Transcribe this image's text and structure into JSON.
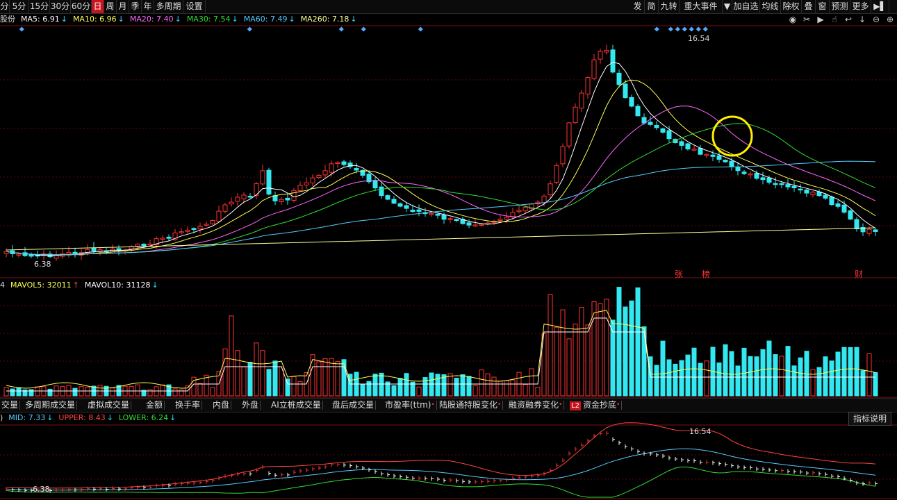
{
  "toolbar": {
    "left": [
      "分",
      "5分",
      "15分",
      "30分",
      "60分",
      "日",
      "周",
      "月",
      "季",
      "年",
      "多周期",
      "设置"
    ],
    "active_index": 5,
    "right": [
      "发",
      "简",
      "九转",
      "重大事件",
      "▼",
      "加自选",
      "均线",
      "除权",
      "叠",
      "窗",
      "预测",
      "更多",
      "▶▌"
    ]
  },
  "ma_row": {
    "prefix": "股份",
    "items": [
      {
        "text": "MA5: 6.91",
        "arrow": "↓",
        "color": "#ffffff"
      },
      {
        "text": "MA10: 6.96",
        "arrow": "↓",
        "color": "#ffff55"
      },
      {
        "text": "MA20: 7.40",
        "arrow": "↓",
        "color": "#ff66ff"
      },
      {
        "text": "MA30: 7.54",
        "arrow": "↓",
        "color": "#33dd33"
      },
      {
        "text": "MA60: 7.49",
        "arrow": "↓",
        "color": "#55ccff"
      },
      {
        "text": "MA260: 7.18",
        "arrow": "↓",
        "color": "#ffff99"
      }
    ]
  },
  "icons": [
    "eye-icon",
    "scissors-icon",
    "play-icon",
    "hand-icon",
    "back-icon",
    "down-icon",
    "zoom-out-icon",
    "zoom-in-icon"
  ],
  "price_labels": {
    "high": "16.54",
    "low": "6.38"
  },
  "markers": {
    "zhang": "张",
    "bang": "榜",
    "cai": "财"
  },
  "vol_row": {
    "prefix": "4",
    "items": [
      {
        "text": "MAVOL5: 32011",
        "arrow": "↑",
        "color": "#ffff55"
      },
      {
        "text": "MAVOL10: 31128",
        "arrow": "↓",
        "color": "#ffffff"
      }
    ]
  },
  "tabs": [
    {
      "label": "交量",
      "dot": false
    },
    {
      "label": "多周期成交量",
      "dot": false
    },
    {
      "label": "虚拟成交量",
      "dot": false
    },
    {
      "label": "金额",
      "dot": false
    },
    {
      "label": "换手率",
      "dot": false
    },
    {
      "label": "内盘",
      "dot": false
    },
    {
      "label": "外盘",
      "dot": false
    },
    {
      "label": "AI立桩成交量",
      "dot": false
    },
    {
      "label": "盘后成交量",
      "dot": false
    },
    {
      "label": "市盈率(ttm)",
      "dot": true
    },
    {
      "label": "陆股通持股变化",
      "dot": true
    },
    {
      "label": "融资融券变化",
      "dot": true
    },
    {
      "label": "资金抄底",
      "dot": true,
      "badge": "L2"
    }
  ],
  "boll_row": {
    "prefix": ")",
    "items": [
      {
        "text": "MID: 7.33",
        "arrow": "↓",
        "color": "#55ccff"
      },
      {
        "text": "UPPER: 8.43",
        "arrow": "↓",
        "color": "#ff4444"
      },
      {
        "text": "LOWER: 6.24",
        "arrow": "↓",
        "color": "#33dd33"
      }
    ]
  },
  "explain_label": "指标说明",
  "colors": {
    "up": "#ff3333",
    "down": "#33e8f0",
    "grid": "#5a0a0a"
  }
}
